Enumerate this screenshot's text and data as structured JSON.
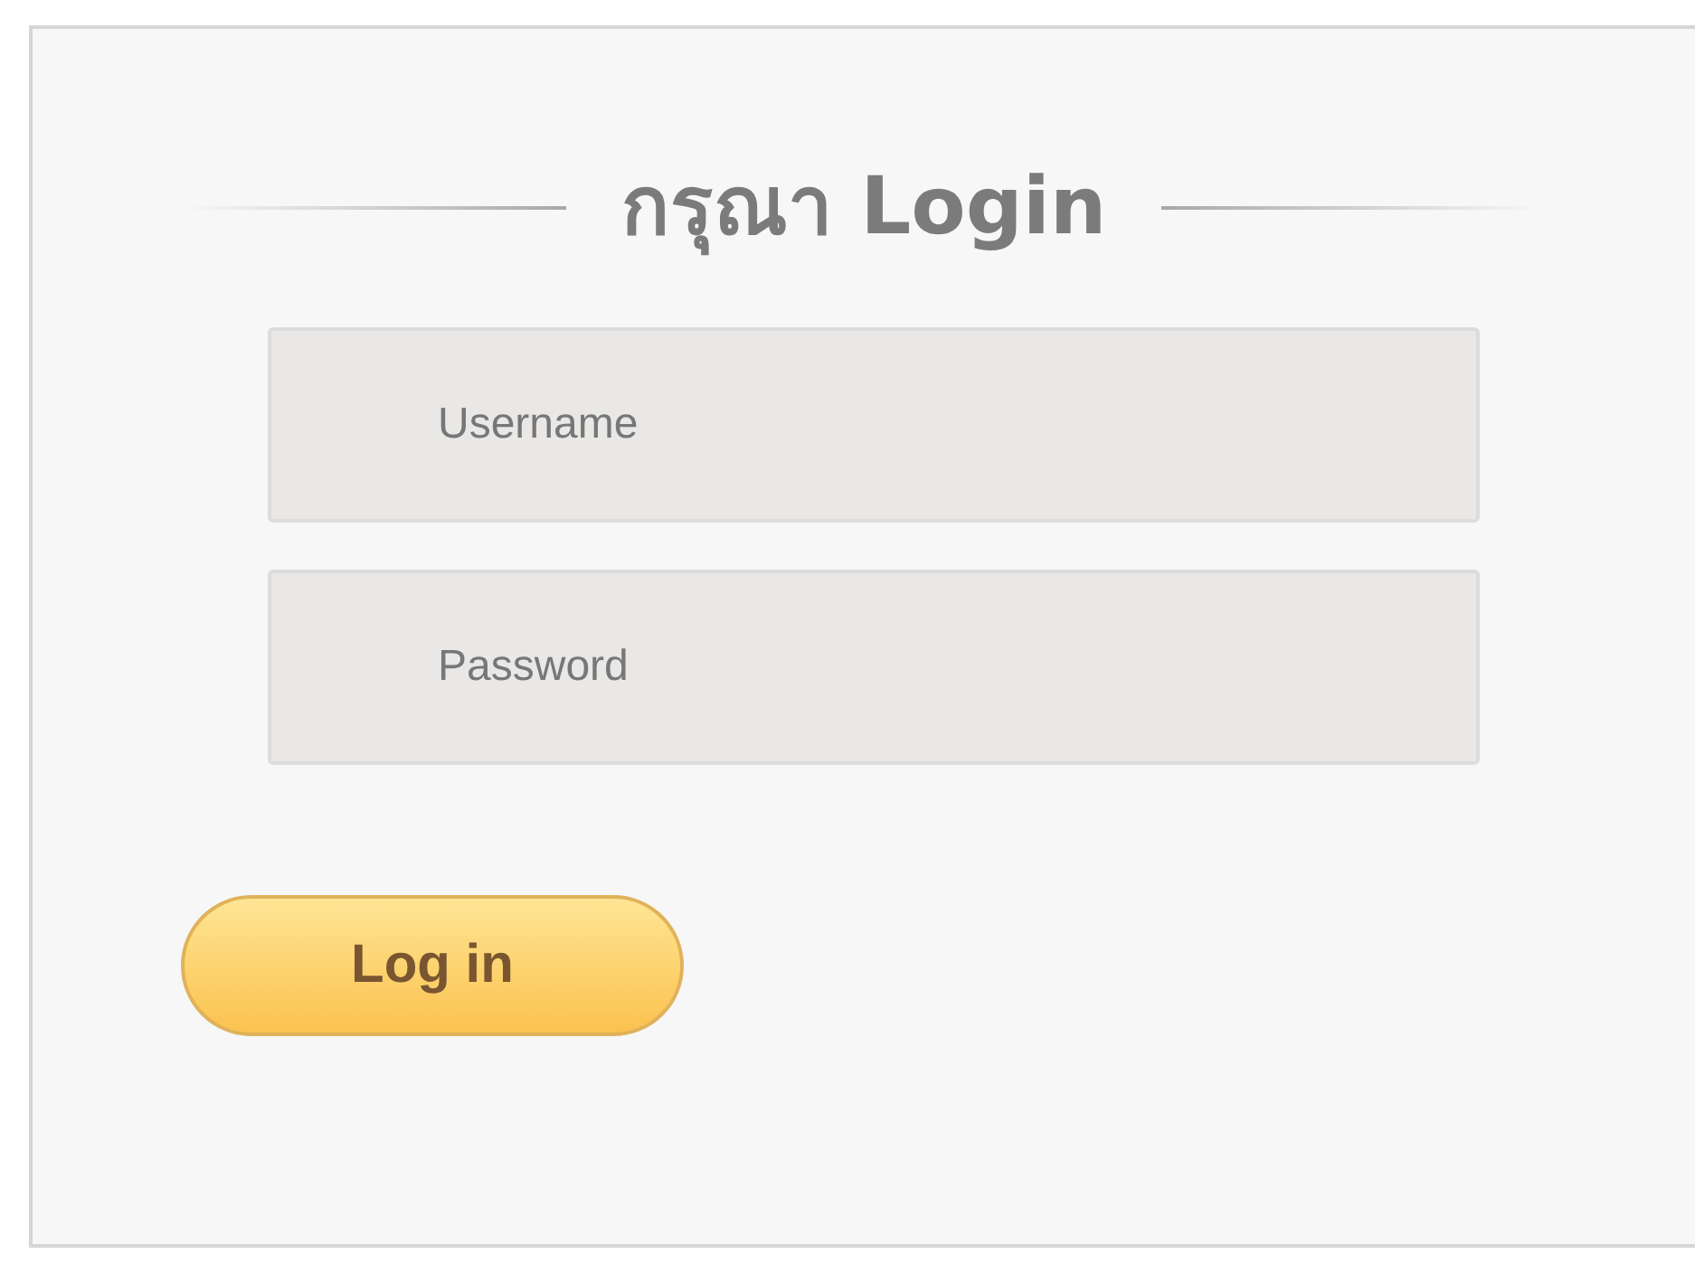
{
  "heading": "กรุณา Login",
  "fields": [
    {
      "placeholder": "Username"
    },
    {
      "placeholder": "Password"
    }
  ],
  "button": "Log in"
}
